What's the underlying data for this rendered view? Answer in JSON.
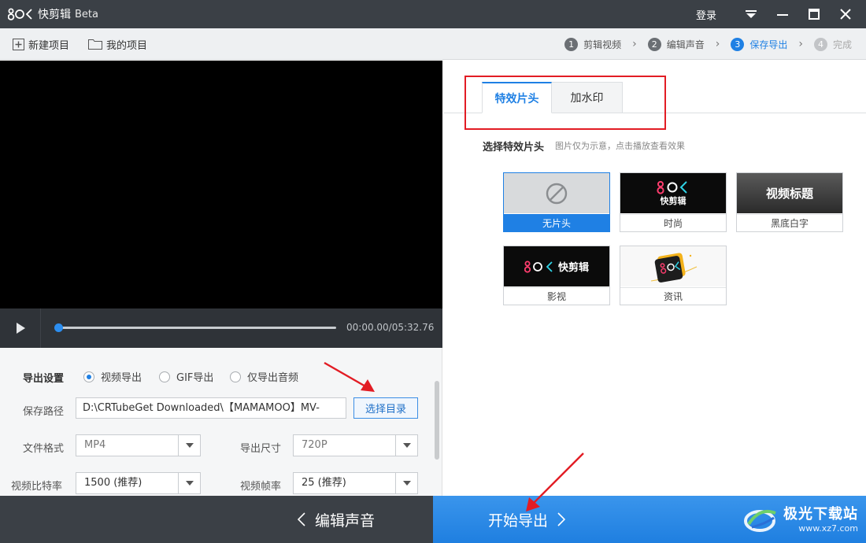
{
  "window": {
    "logo_mark": "8OK",
    "title": "快剪辑",
    "beta": "Beta",
    "login": "登录"
  },
  "toolbar": {
    "new_project": "新建项目",
    "my_projects": "我的项目",
    "steps": [
      {
        "num": "1",
        "label": "剪辑视频",
        "state": "done"
      },
      {
        "num": "2",
        "label": "编辑声音",
        "state": "done"
      },
      {
        "num": "3",
        "label": "保存导出",
        "state": "active"
      },
      {
        "num": "4",
        "label": "完成",
        "state": "disabled"
      }
    ]
  },
  "player": {
    "time": "00:00.00/05:32.76",
    "progress": 0.0
  },
  "export": {
    "section_label": "导出设置",
    "modes": [
      "视频导出",
      "GIF导出",
      "仅导出音频"
    ],
    "selected_mode": "视频导出",
    "path_label": "保存路径",
    "path_value": "D:\\CRTubeGet Downloaded\\【MAMAMOO】MV-",
    "choose_dir": "选择目录",
    "format_label": "文件格式",
    "format_value": "MP4",
    "size_label": "导出尺寸",
    "size_value": "720P",
    "bitrate_label": "视频比特率",
    "bitrate_value": "1500 (推荐)",
    "fps_label": "视频帧率",
    "fps_value": "25 (推荐)"
  },
  "right_panel": {
    "tabs": [
      "特效片头",
      "加水印"
    ],
    "active_tab": "特效片头",
    "intro_title": "选择特效片头",
    "intro_hint": "图片仅为示意，点击播放查看效果",
    "intros": [
      {
        "label": "无片头",
        "selected": true
      },
      {
        "label": "时尚",
        "selected": false,
        "thumb_text": "快剪辑"
      },
      {
        "label": "黑底白字",
        "selected": false,
        "thumb_text": "视频标题"
      },
      {
        "label": "影视",
        "selected": false,
        "thumb_text": "快剪辑"
      },
      {
        "label": "资讯",
        "selected": false
      }
    ]
  },
  "bottom": {
    "back_label": "编辑声音",
    "start_label": "开始导出"
  },
  "watermark": {
    "main": "极光下载站",
    "sub": "www.xz7.com"
  },
  "colors": {
    "accent": "#1f80e4",
    "titlebar": "#3b4046",
    "annotation_red": "#e21c24",
    "brand_pink": "#ff3d6e",
    "brand_cyan": "#2fd3e6"
  }
}
